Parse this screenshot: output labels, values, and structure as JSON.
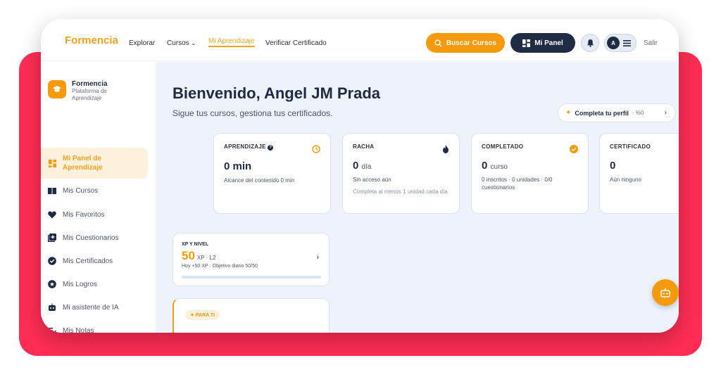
{
  "nav": {
    "brand": "Formencia",
    "explore": "Explorar",
    "courses": "Cursos",
    "my_learning": "Mi Aprendizaje",
    "verify": "Verificar Certificado",
    "search_button": "Buscar Cursos",
    "panel_button": "Mi Panel",
    "avatar_initial": "A",
    "logout": "Salir"
  },
  "sidebar": {
    "title": "Formencia",
    "subtitle": "Plataforma de Aprendizaje",
    "items": [
      {
        "label": "Mi Panel de Aprendizaje",
        "icon": "dashboard-icon"
      },
      {
        "label": "Mis Cursos",
        "icon": "book-icon"
      },
      {
        "label": "Mis Favoritos",
        "icon": "heart-icon"
      },
      {
        "label": "Mis Cuestionarios",
        "icon": "quiz-icon"
      },
      {
        "label": "Mis Certificados",
        "icon": "badge-check-icon"
      },
      {
        "label": "Mis Logros",
        "icon": "trophy-icon"
      },
      {
        "label": "Mi asistente de IA",
        "icon": "robot-icon"
      },
      {
        "label": "Mis Notas",
        "icon": "notes-icon"
      }
    ]
  },
  "main": {
    "heading": "Bienvenido, Angel JM Prada",
    "subheading": "Sigue tus cursos, gestiona tus certificados.",
    "profile_cta": "Completa tu perfil",
    "profile_pct": "%0",
    "cards": [
      {
        "label": "APRENDIZAJE",
        "value": "0 min",
        "unit": "",
        "note": "Alcance del contenido 0 min",
        "note2": ""
      },
      {
        "label": "RACHA",
        "value": "0",
        "unit": "día",
        "note": "Sin acceso aún",
        "note2": "Completa al menos 1 unidad cada día"
      },
      {
        "label": "COMPLETADO",
        "value": "0",
        "unit": "curso",
        "note": "0 inscritos · 0 unidades · 0/0 cuestionarios",
        "note2": ""
      },
      {
        "label": "CERTIFICADO",
        "value": "0",
        "unit": "",
        "note": "Aún ninguno",
        "note2": ""
      }
    ],
    "xp": {
      "label": "XP Y NIVEL",
      "value": "50",
      "suffix": "XP · L2",
      "note": "Hoy +50 XP · Objetivo diario 50/50",
      "progress": 1.0
    },
    "for_you_chip": "PARA TI"
  },
  "colors": {
    "accent": "#f59a0c",
    "dark": "#1f2a44",
    "frame": "#ff2d55"
  }
}
